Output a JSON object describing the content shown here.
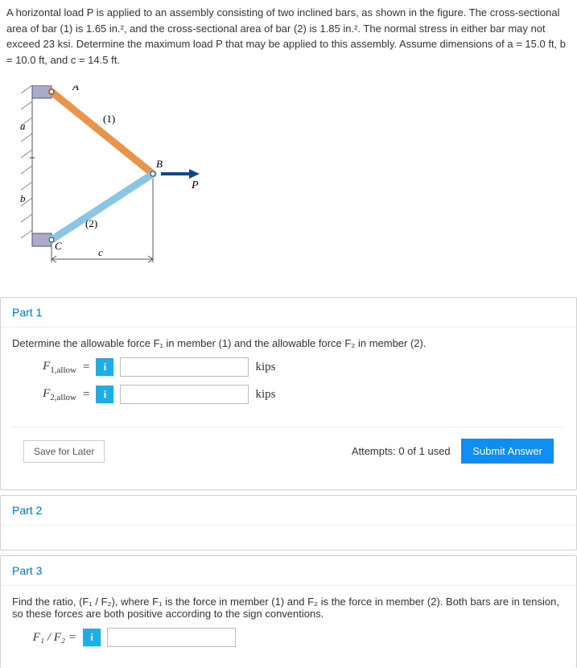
{
  "intro": "A horizontal load P is applied to an assembly consisting of two inclined bars, as shown in the figure. The cross-sectional area of bar (1) is 1.65 in.², and the cross-sectional area of bar (2) is 1.85 in.². The normal stress in either bar may not exceed 23 ksi. Determine the maximum load P that may be applied to this assembly. Assume dimensions of a = 15.0 ft, b = 10.0 ft, and c = 14.5 ft.",
  "figure": {
    "labelA": "A",
    "labelB": "B",
    "labelC": "C",
    "labelP": "P",
    "label_a": "a",
    "label_b": "b",
    "label_c": "c",
    "bar1": "(1)",
    "bar2": "(2)"
  },
  "part1": {
    "title": "Part 1",
    "prompt": "Determine the allowable force F₁ in member (1) and the allowable force F₂ in member (2).",
    "f1label": "F",
    "f1sub": "1,allow",
    "f2label": "F",
    "f2sub": "2,allow",
    "eq": "=",
    "unit": "kips",
    "save": "Save for Later",
    "attempts": "Attempts: 0 of 1 used",
    "submit": "Submit Answer"
  },
  "part2": {
    "title": "Part 2"
  },
  "part3": {
    "title": "Part 3",
    "prompt": "Find the ratio, (F₁ / F₂), where F₁ is the force in member (1) and F₂ is the force in member (2). Both bars are in tension, so these forces are both positive according to the sign conventions.",
    "ratioLabel": "F₁ / F₂ =",
    "eq": "="
  }
}
